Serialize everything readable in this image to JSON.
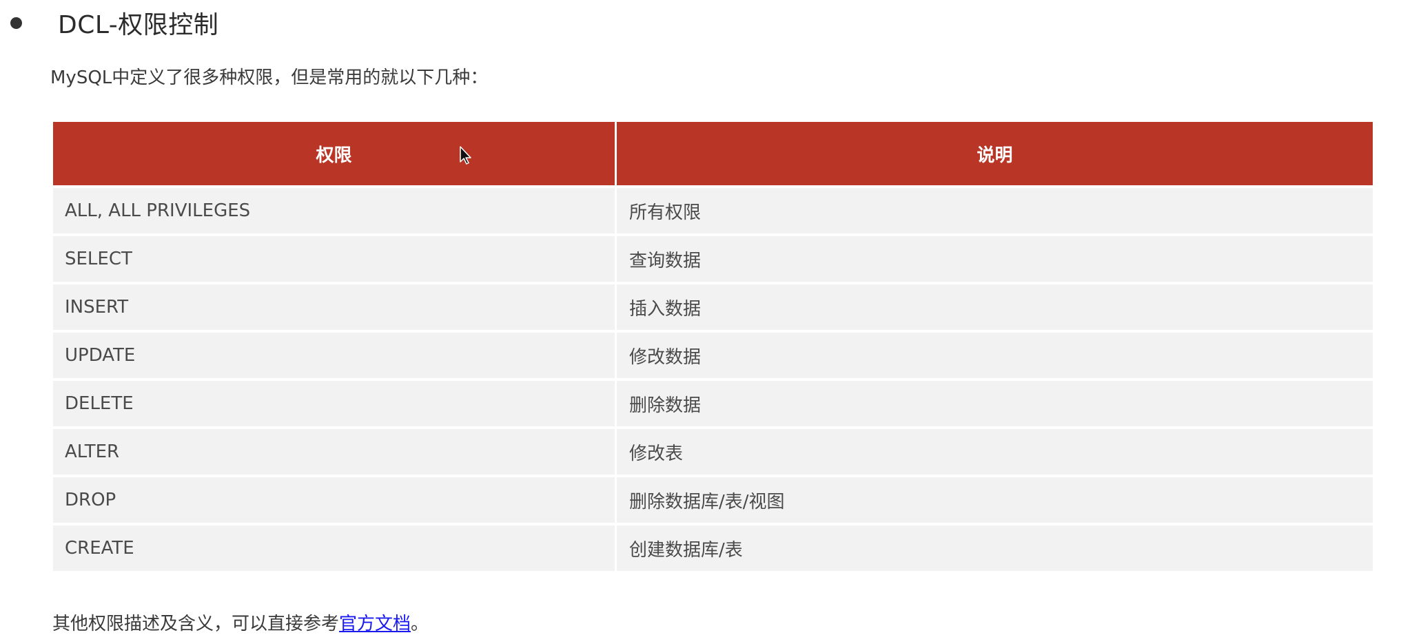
{
  "heading": "DCL-权限控制",
  "intro": "MySQL中定义了很多种权限，但是常用的就以下几种：",
  "table": {
    "headers": [
      "权限",
      "说明"
    ],
    "rows": [
      [
        "ALL, ALL PRIVILEGES",
        "所有权限"
      ],
      [
        "SELECT",
        "查询数据"
      ],
      [
        "INSERT",
        "插入数据"
      ],
      [
        "UPDATE",
        "修改数据"
      ],
      [
        "DELETE",
        "删除数据"
      ],
      [
        "ALTER",
        "修改表"
      ],
      [
        "DROP",
        "删除数据库/表/视图"
      ],
      [
        "CREATE",
        "创建数据库/表"
      ]
    ]
  },
  "footer": {
    "text": "其他权限描述及含义，可以直接参考",
    "link_text": "官方文档",
    "suffix": "。"
  },
  "colors": {
    "header_bg": "#b93626",
    "row_bg": "#f2f2f2",
    "link": "#1a1aee"
  },
  "icons": [
    "bullet-icon",
    "mouse-cursor-icon"
  ]
}
